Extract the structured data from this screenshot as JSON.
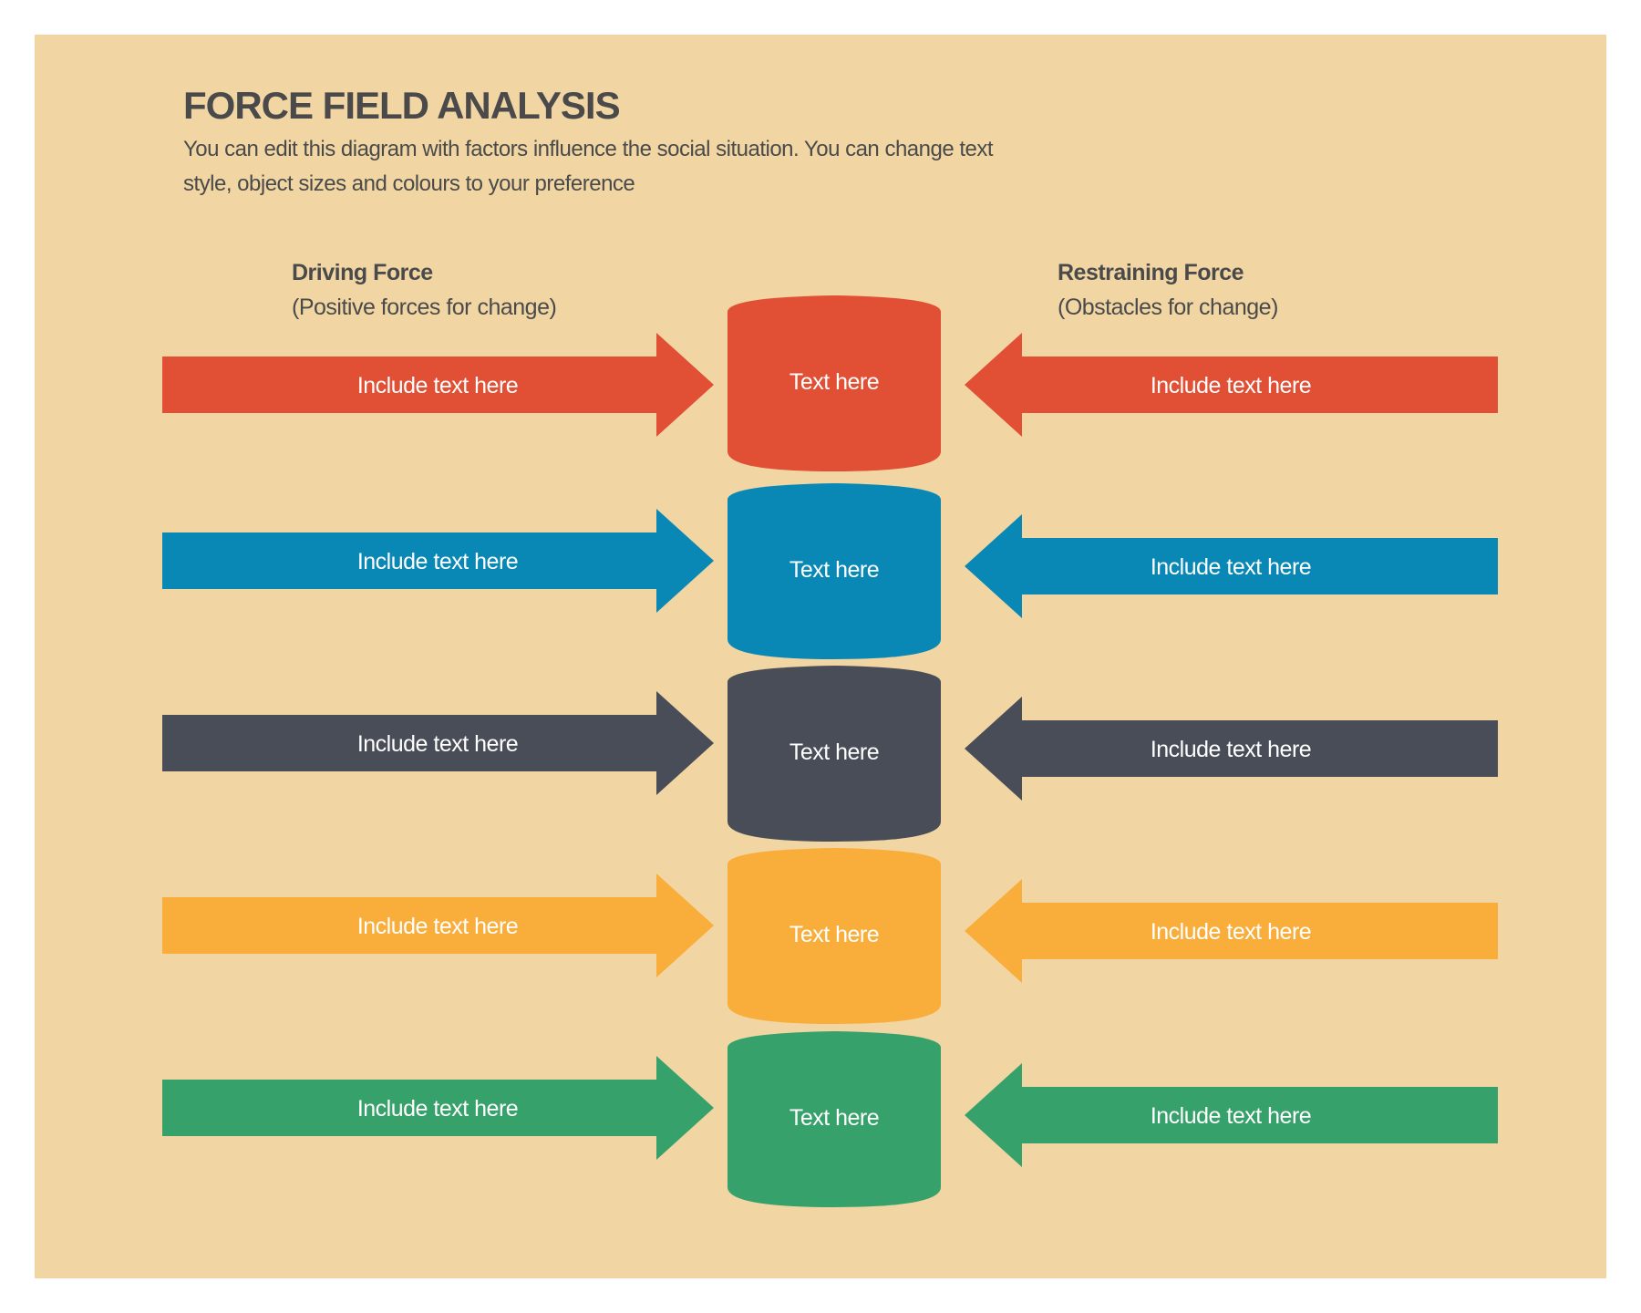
{
  "header": {
    "title": "FORCE FIELD ANALYSIS",
    "subtitle": "You can edit this diagram with factors influence the social situation.  You can change text style, object sizes and colours to your preference"
  },
  "columns": {
    "driving": {
      "heading": "Driving Force",
      "subheading": "(Positive forces for change)"
    },
    "restraining": {
      "heading": "Restraining Force",
      "subheading": "(Obstacles for change)"
    }
  },
  "colors": {
    "background": "#F1D6A4",
    "text": "#4A4A4A"
  },
  "rows": [
    {
      "color": "#E14F34",
      "driving_text": "Include text here",
      "center_text": "Text here",
      "restraining_text": "Include text here"
    },
    {
      "color": "#0A88B5",
      "driving_text": "Include text here",
      "center_text": "Text here",
      "restraining_text": "Include text here"
    },
    {
      "color": "#484D57",
      "driving_text": "Include text here",
      "center_text": "Text here",
      "restraining_text": "Include text here"
    },
    {
      "color": "#F9AE3B",
      "driving_text": "Include text here",
      "center_text": "Text here",
      "restraining_text": "Include text here"
    },
    {
      "color": "#37A16B",
      "driving_text": "Include text here",
      "center_text": "Text here",
      "restraining_text": "Include text here"
    }
  ]
}
